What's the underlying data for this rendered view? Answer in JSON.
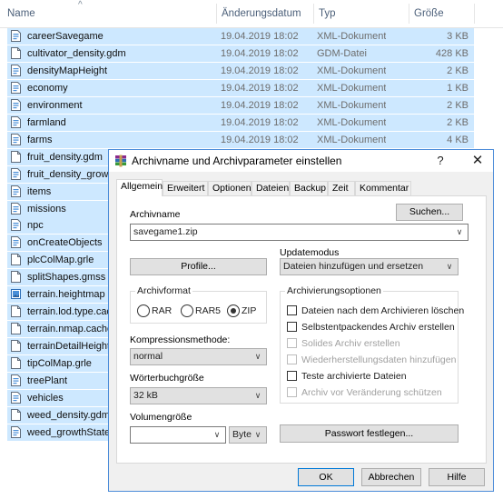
{
  "explorer": {
    "columns": {
      "name": "Name",
      "date": "Änderungsdatum",
      "type": "Typ",
      "size": "Größe"
    },
    "files": [
      {
        "name": "careerSavegame",
        "date": "19.04.2019 18:02",
        "type": "XML-Dokument",
        "size": "3 KB",
        "icon": "xml-file-icon"
      },
      {
        "name": "cultivator_density.gdm",
        "date": "19.04.2019 18:02",
        "type": "GDM-Datei",
        "size": "428 KB",
        "icon": "blank-file-icon"
      },
      {
        "name": "densityMapHeight",
        "date": "19.04.2019 18:02",
        "type": "XML-Dokument",
        "size": "2 KB",
        "icon": "xml-file-icon"
      },
      {
        "name": "economy",
        "date": "19.04.2019 18:02",
        "type": "XML-Dokument",
        "size": "1 KB",
        "icon": "xml-file-icon"
      },
      {
        "name": "environment",
        "date": "19.04.2019 18:02",
        "type": "XML-Dokument",
        "size": "2 KB",
        "icon": "xml-file-icon"
      },
      {
        "name": "farmland",
        "date": "19.04.2019 18:02",
        "type": "XML-Dokument",
        "size": "2 KB",
        "icon": "xml-file-icon"
      },
      {
        "name": "farms",
        "date": "19.04.2019 18:02",
        "type": "XML-Dokument",
        "size": "4 KB",
        "icon": "xml-file-icon"
      },
      {
        "name": "fruit_density.gdm",
        "date": "",
        "type": "",
        "size": "",
        "icon": "blank-file-icon"
      },
      {
        "name": "fruit_density_growt",
        "date": "",
        "type": "",
        "size": "",
        "icon": "xml-file-icon"
      },
      {
        "name": "items",
        "date": "",
        "type": "",
        "size": "",
        "icon": "xml-file-icon"
      },
      {
        "name": "missions",
        "date": "",
        "type": "",
        "size": "",
        "icon": "xml-file-icon"
      },
      {
        "name": "npc",
        "date": "",
        "type": "",
        "size": "",
        "icon": "xml-file-icon"
      },
      {
        "name": "onCreateObjects",
        "date": "",
        "type": "",
        "size": "",
        "icon": "xml-file-icon"
      },
      {
        "name": "plcColMap.grle",
        "date": "",
        "type": "",
        "size": "",
        "icon": "blank-file-icon"
      },
      {
        "name": "splitShapes.gmss",
        "date": "",
        "type": "",
        "size": "",
        "icon": "blank-file-icon"
      },
      {
        "name": "terrain.heightmap",
        "date": "",
        "type": "",
        "size": "",
        "icon": "image-file-icon"
      },
      {
        "name": "terrain.lod.type.cac",
        "date": "",
        "type": "",
        "size": "",
        "icon": "blank-file-icon"
      },
      {
        "name": "terrain.nmap.cache",
        "date": "",
        "type": "",
        "size": "",
        "icon": "blank-file-icon"
      },
      {
        "name": "terrainDetailHeight_",
        "date": "",
        "type": "",
        "size": "",
        "icon": "blank-file-icon"
      },
      {
        "name": "tipColMap.grle",
        "date": "",
        "type": "",
        "size": "",
        "icon": "blank-file-icon"
      },
      {
        "name": "treePlant",
        "date": "",
        "type": "",
        "size": "",
        "icon": "xml-file-icon"
      },
      {
        "name": "vehicles",
        "date": "",
        "type": "",
        "size": "",
        "icon": "xml-file-icon"
      },
      {
        "name": "weed_density.gdm",
        "date": "",
        "type": "",
        "size": "",
        "icon": "blank-file-icon"
      },
      {
        "name": "weed_growthState",
        "date": "",
        "type": "",
        "size": "",
        "icon": "xml-file-icon"
      }
    ],
    "selection_color": "#cde8ff"
  },
  "dialog": {
    "title": "Archivname und Archivparameter einstellen",
    "help_label": "?",
    "close_label": "✕",
    "tabs": [
      "Allgemein",
      "Erweitert",
      "Optionen",
      "Dateien",
      "Backup",
      "Zeit",
      "Kommentar"
    ],
    "active_tab": "Allgemein",
    "archive_name_label": "Archivname",
    "search_button": "Suchen...",
    "archive_name_value": "savegame1.zip",
    "update_mode_label": "Updatemodus",
    "update_mode_value": "Dateien hinzufügen und ersetzen",
    "profiles_button": "Profile...",
    "archive_format": {
      "title": "Archivformat",
      "options": [
        "RAR",
        "RAR5",
        "ZIP"
      ],
      "selected": "ZIP"
    },
    "archive_options": {
      "title": "Archivierungsoptionen",
      "items": [
        {
          "label": "Dateien nach dem Archivieren löschen",
          "checked": false,
          "enabled": true
        },
        {
          "label": "Selbstentpackendes Archiv erstellen",
          "checked": false,
          "enabled": true
        },
        {
          "label": "Solides Archiv erstellen",
          "checked": false,
          "enabled": false
        },
        {
          "label": "Wiederherstellungsdaten hinzufügen",
          "checked": false,
          "enabled": false
        },
        {
          "label": "Teste archivierte Dateien",
          "checked": false,
          "enabled": true
        },
        {
          "label": "Archiv vor Veränderung schützen",
          "checked": false,
          "enabled": false
        }
      ]
    },
    "compression_label": "Kompressionsmethode:",
    "compression_value": "normal",
    "dictionary_label": "Wörterbuchgröße",
    "dictionary_value": "32 kB",
    "volume_label": "Volumengröße",
    "volume_value": "",
    "volume_unit": "Byte",
    "password_button": "Passwort festlegen...",
    "ok_button": "OK",
    "cancel_button": "Abbrechen",
    "help_button": "Hilfe"
  }
}
